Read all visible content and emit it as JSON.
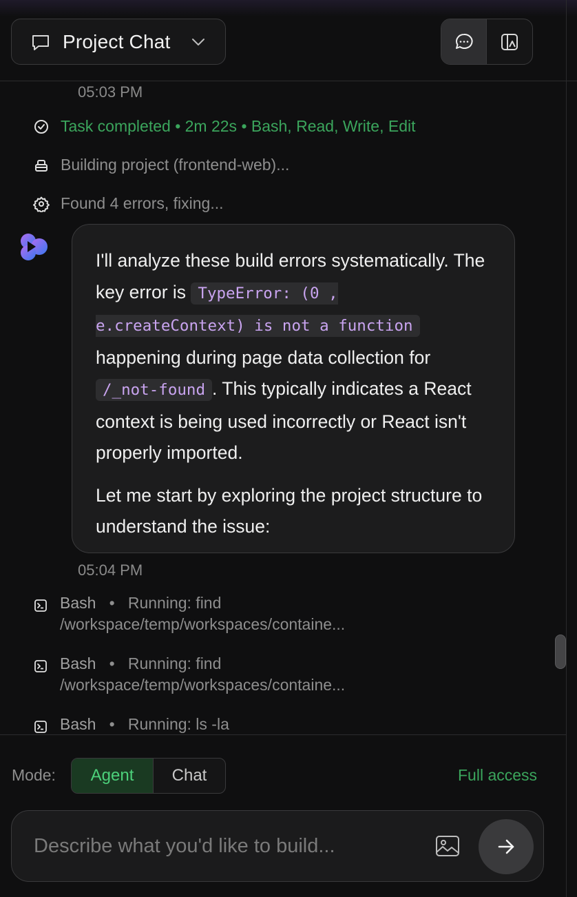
{
  "header": {
    "chat_title": "Project Chat",
    "view_modes": [
      "chat-view",
      "split-view"
    ]
  },
  "messages": {
    "time_1": "05:03 PM",
    "status": [
      {
        "icon": "check-circle-icon",
        "text": "Task completed • 2m 22s • Bash, Read, Write, Edit",
        "color": "#3ba55c"
      },
      {
        "icon": "build-icon",
        "text": "Building project (frontend-web)...",
        "color": "#8e8e8e"
      },
      {
        "icon": "gear-icon",
        "text": "Found 4 errors, fixing...",
        "color": "#8e8e8e"
      }
    ],
    "assistant": {
      "p1_a": "I'll analyze these build errors systematically. The key error is ",
      "code_1": "TypeError: (0 , e.createContext) is not a function",
      "p1_b": " happening during page data collection for ",
      "code_2": "/_not-found",
      "p1_c": ". This typically indicates a React context is being used incorrectly or React isn't properly imported.",
      "p2": "Let me start by exploring the project structure to understand the issue:"
    },
    "time_2": "05:04 PM",
    "tools": [
      {
        "tool": "Bash",
        "sep": "•",
        "action": "Running: find",
        "detail": "/workspace/temp/workspaces/containe..."
      },
      {
        "tool": "Bash",
        "sep": "•",
        "action": "Running: find",
        "detail": "/workspace/temp/workspaces/containe..."
      },
      {
        "tool": "Bash",
        "sep": "•",
        "action": "Running: ls -la",
        "detail": ""
      }
    ]
  },
  "footer": {
    "mode_label": "Mode:",
    "modes": {
      "active": "Agent",
      "inactive": "Chat"
    },
    "access": "Full access",
    "input_placeholder": "Describe what you'd like to build..."
  },
  "colors": {
    "accent_green": "#3ba55c",
    "code_purple": "#c9a4f0",
    "background": "#0f0f10"
  }
}
